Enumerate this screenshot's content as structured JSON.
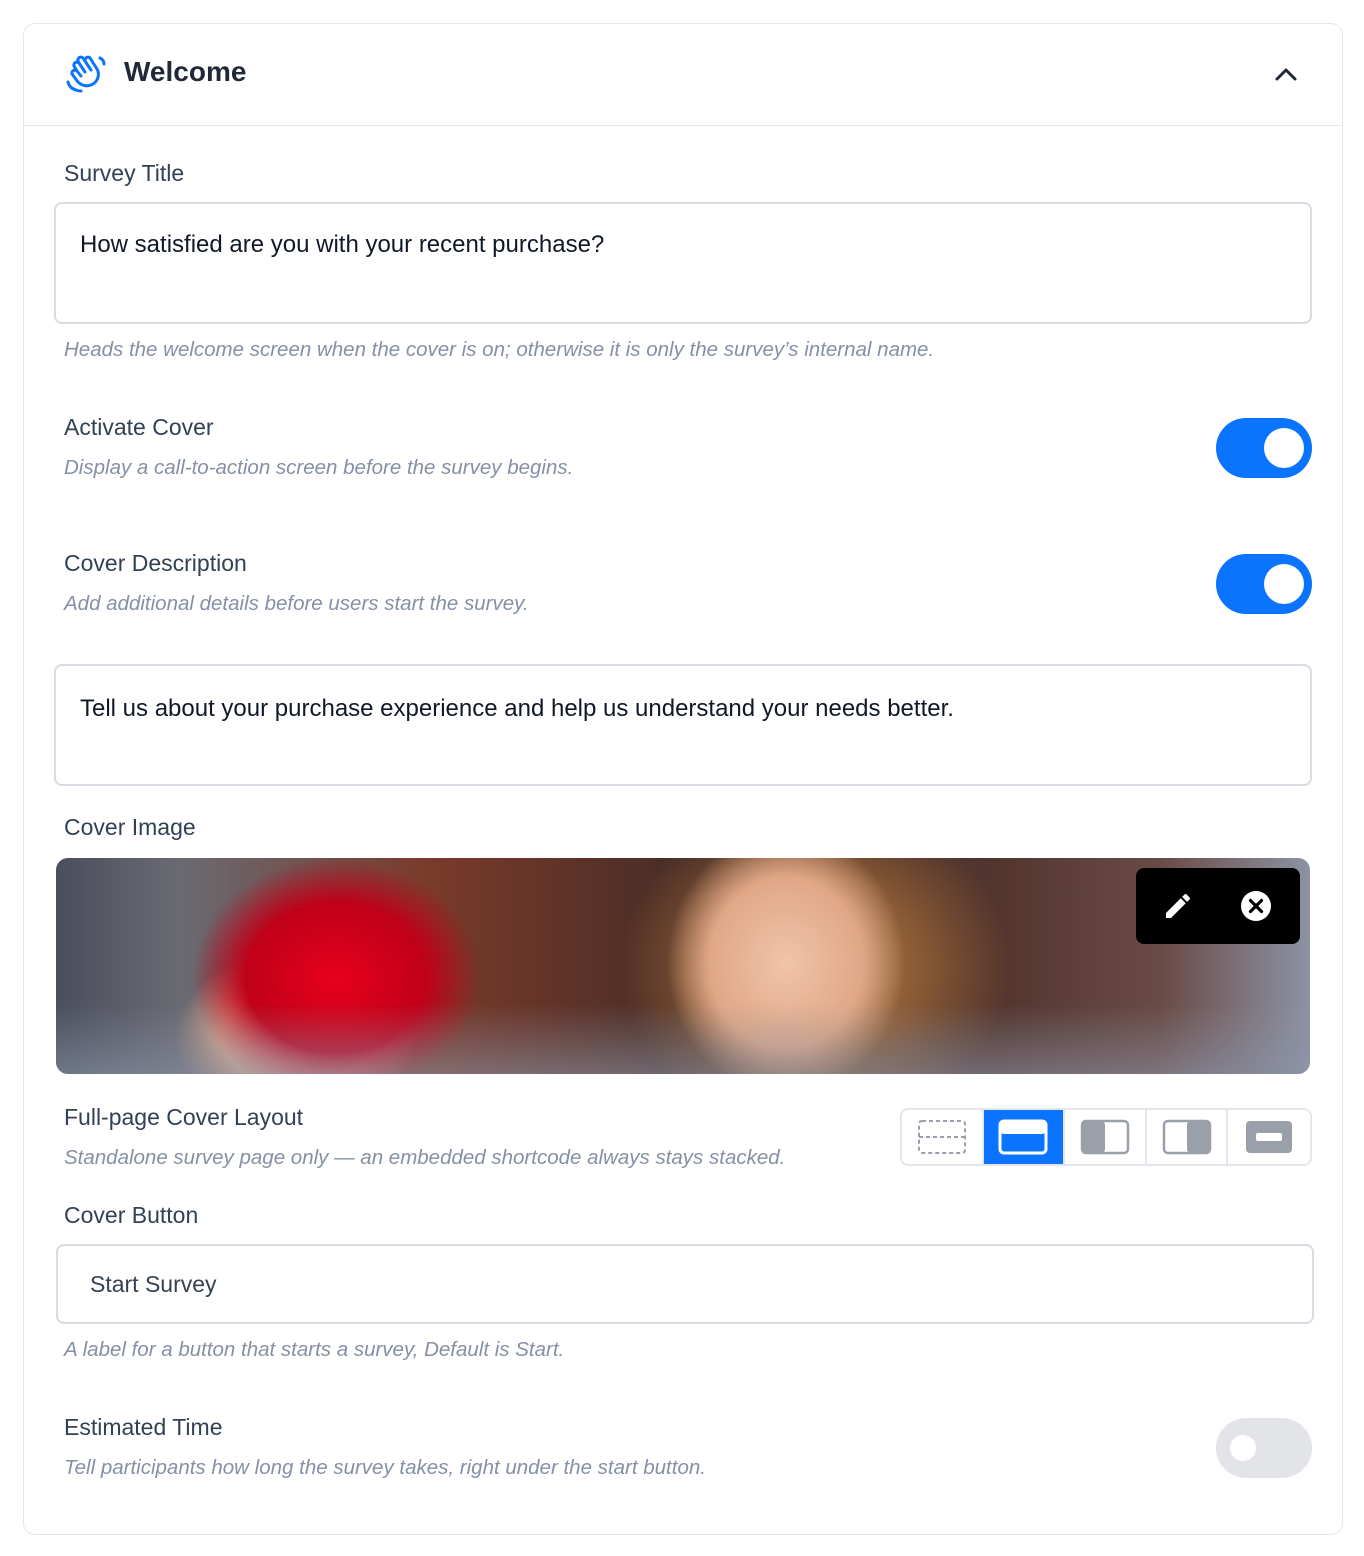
{
  "header": {
    "title": "Welcome",
    "icon": "waving-hand-icon",
    "collapse_icon": "chevron-up-icon"
  },
  "survey_title": {
    "label": "Survey Title",
    "value": "How satisfied are you with your recent purchase?",
    "help": "Heads the welcome screen when the cover is on; otherwise it is only the survey’s internal name."
  },
  "activate_cover": {
    "label": "Activate Cover",
    "help": "Display a call-to-action screen before the survey begins.",
    "enabled": true
  },
  "cover_description": {
    "label": "Cover Description",
    "help": "Add additional details before users start the survey.",
    "enabled": true,
    "value": "Tell us about your purchase experience and help us understand your needs better."
  },
  "cover_image": {
    "label": "Cover Image",
    "actions": [
      "pencil-icon",
      "close-circle-icon"
    ]
  },
  "cover_layout": {
    "label": "Full-page Cover Layout",
    "help": "Standalone survey page only — an embedded shortcode always stays stacked.",
    "options": [
      "no-cover-layout-icon",
      "stacked-layout-icon",
      "left-image-layout-icon",
      "right-image-layout-icon",
      "banner-layout-icon"
    ],
    "selected_index": 1
  },
  "cover_button": {
    "label": "Cover Button",
    "value": "Start Survey",
    "help": "A label for a button that starts a survey, Default is Start."
  },
  "estimated_time": {
    "label": "Estimated Time",
    "help": "Tell participants how long the survey takes, right under the start button.",
    "enabled": false
  },
  "colors": {
    "accent": "#0a74ff",
    "toggle_off": "#e2e4e8",
    "help_text": "#8590a6"
  }
}
